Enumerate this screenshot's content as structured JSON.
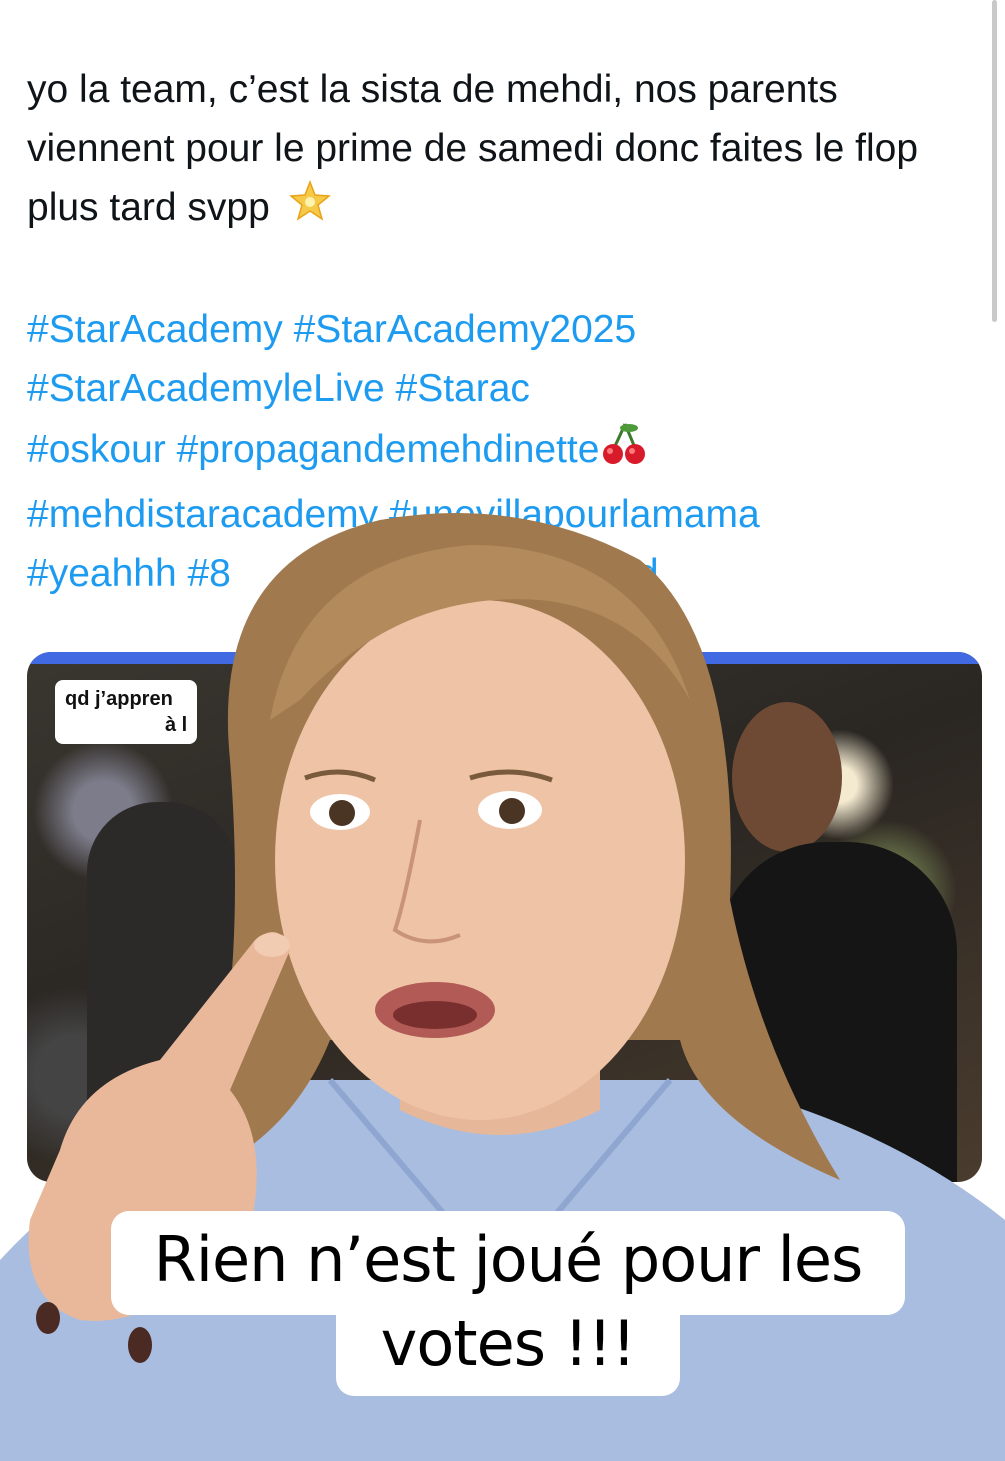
{
  "tweet": {
    "text": "yo la team, c’est la sista de mehdi, nos parents viennent pour le prime de samedi donc faites le flop plus tard svpp",
    "text_emoji": "glowing-star-emoji",
    "hashtag_lines": [
      "#StarAcademy #StarAcademy2025",
      "#StarAcademyleLive #Starac",
      "#oskour #propagandemehdinette",
      "#mehdistaracademy #unevillapourlamama",
      "#yeahhh #8"
    ],
    "hashtag_line_3_emoji": "cherries-emoji",
    "hashtag_line_5_tail": "aled"
  },
  "media": {
    "caption_line_1": "qd j’appren",
    "caption_line_2": "à l"
  },
  "overlay_caption": {
    "line_1": "Rien n’est joué pour les",
    "line_2": "votes !!!"
  },
  "colors": {
    "hashtag": "#1d9bf0",
    "text": "#0f1419",
    "caption_bg": "#ffffff"
  }
}
